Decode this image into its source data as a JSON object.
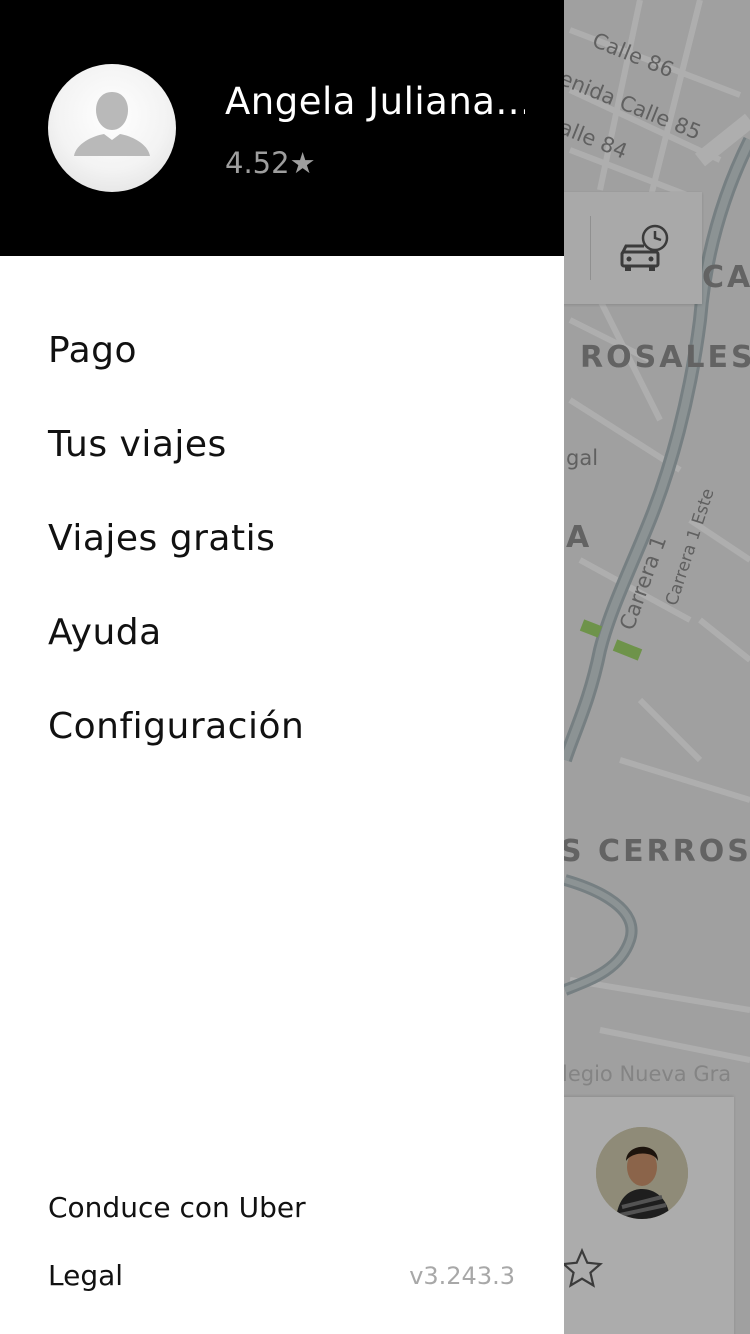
{
  "map": {
    "street_labels": [
      "Calle 86",
      "enida Calle 85",
      "alle 84",
      "Carrera 1",
      "Carrera 1 Este",
      "gal",
      "legio Nueva Gra"
    ],
    "district_labels": [
      "ROSALES",
      "CA",
      "A",
      "S CERROS"
    ]
  },
  "profile": {
    "name": "Angela Juliana...",
    "rating": "4.52★"
  },
  "menu": {
    "items": [
      {
        "label": "Pago"
      },
      {
        "label": "Tus viajes"
      },
      {
        "label": "Viajes gratis"
      },
      {
        "label": "Ayuda"
      },
      {
        "label": "Configuración"
      }
    ]
  },
  "footer": {
    "drive_label": "Conduce con Uber",
    "legal_label": "Legal",
    "version": "v3.243.3"
  },
  "icons": {
    "schedule": "car-clock-icon",
    "avatar_placeholder": "user-silhouette-icon",
    "favorite": "star-outline-icon"
  }
}
